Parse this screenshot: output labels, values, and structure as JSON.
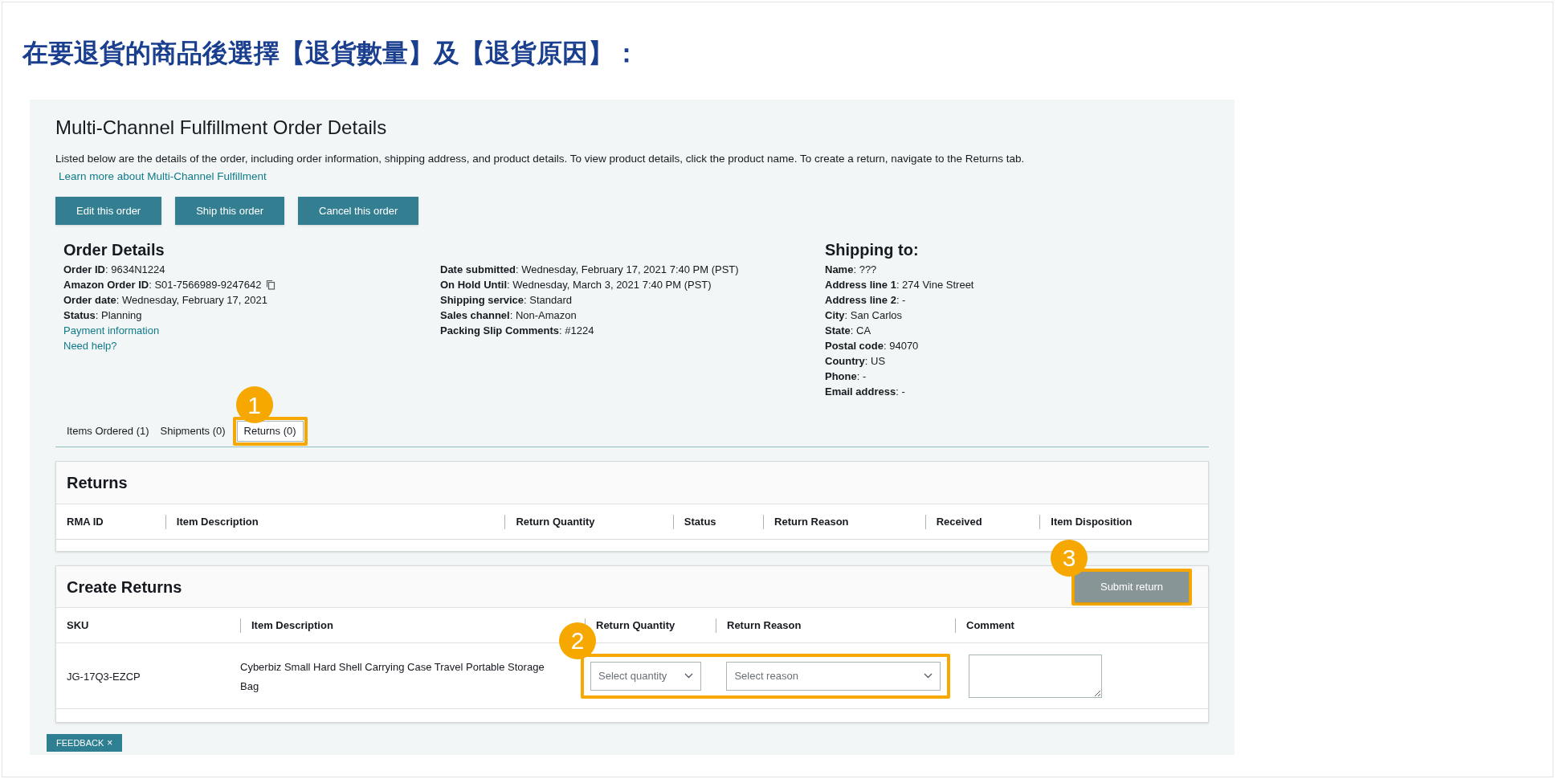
{
  "caption": "在要退貨的商品後選擇【退貨數量】及【退貨原因】：",
  "page": {
    "title": "Multi-Channel Fulfillment Order Details",
    "description": "Listed below are the details of the order, including order information, shipping address, and product details. To view product details, click the product name. To create a return, navigate to the Returns tab.",
    "learn_more_link": "Learn more about Multi-Channel Fulfillment",
    "buttons": [
      "Edit this order",
      "Ship this order",
      "Cancel this order"
    ]
  },
  "order_details": {
    "title": "Order Details",
    "fields": [
      {
        "text": "**Order ID**: 9634N1224",
        "copy": false
      },
      {
        "text": "**Amazon Order ID**: S01-7566989-9247642",
        "copy": true
      },
      {
        "text": "**Order date**: Wednesday, February 17, 2021",
        "copy": false
      },
      {
        "text": "**Status**: Planning",
        "copy": false
      }
    ],
    "links": [
      "Payment information",
      "Need help?"
    ],
    "more_fields": [
      "**Date submitted**: Wednesday, February 17, 2021 7:40 PM (PST)",
      "**On Hold Until**: Wednesday, March 3, 2021 7:40 PM (PST)",
      "**Shipping service**: Standard",
      "**Sales channel**: Non-Amazon",
      "**Packing Slip Comments**: #1224"
    ]
  },
  "shipping": {
    "title": "Shipping to:",
    "fields": [
      "**Name**: ???",
      "**Address line 1**: 274 Vine Street",
      "**Address line 2**: -",
      "**City**: San Carlos",
      "**State**: CA",
      "**Postal code**: 94070",
      "**Country**: US",
      "**Phone**: -",
      "**Email address**: -"
    ]
  },
  "tabs": [
    {
      "label": "Items Ordered (1)",
      "selected": false
    },
    {
      "label": "Shipments (0)",
      "selected": false
    },
    {
      "label": "Returns (0)",
      "selected": true,
      "callout": "1"
    }
  ],
  "returns": {
    "title": "Returns",
    "columns": [
      "RMA ID",
      "Item Description",
      "Return Quantity",
      "Status",
      "Return Reason",
      "Received",
      "Item Disposition"
    ]
  },
  "create_returns": {
    "title": "Create Returns",
    "submit_button": "Submit return",
    "submit_callout": "3",
    "columns": [
      "SKU",
      "Item Description",
      "Return Quantity",
      "Return Reason",
      "Comment"
    ],
    "rows": [
      {
        "sku": "JG-17Q3-EZCP",
        "description": "Cyberbiz Small Hard Shell Carrying Case Travel Portable Storage Bag",
        "quantity": {
          "placeholder": "Select quantity"
        },
        "reason": {
          "placeholder": "Select reason"
        },
        "callout": "2"
      }
    ]
  },
  "feedback": {
    "label": "FEEDBACK",
    "close": "×"
  }
}
